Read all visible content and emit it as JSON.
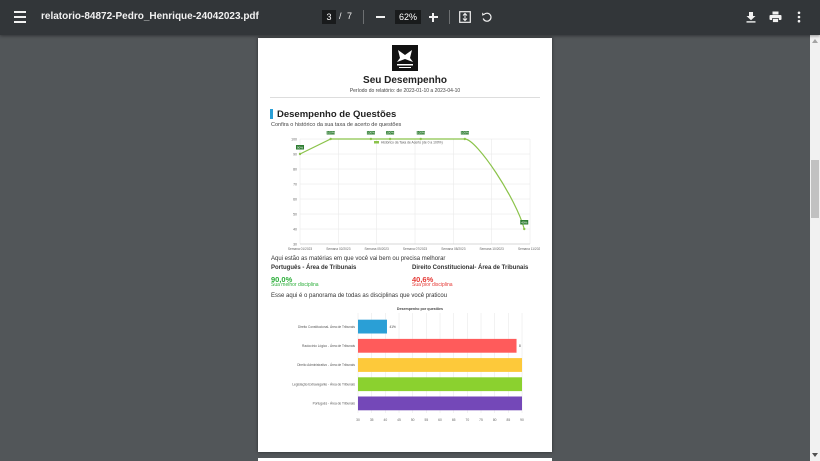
{
  "toolbar": {
    "filename": "relatorio-84872-Pedro_Henrique-24042023.pdf",
    "current_page": "3",
    "page_separator": "/",
    "total_pages": "7",
    "zoom": "62%"
  },
  "report": {
    "title": "Seu Desempenho",
    "period": "Período do relatório: de 2023-01-10 a 2023-04-10",
    "section_title": "Desempenho de Questões",
    "section_subtitle": "Confira o histórico da sua taxa de acerto de questões",
    "subjects_intro": "Aqui estão as matérias em que você vai bem ou precisa melhorar",
    "best_subject": "Português - Área de Tribunais",
    "best_pct": "90,0%",
    "best_hint": "Sua melhor disciplina",
    "worst_subject": "Direito Constitucional- Área de Tribunais",
    "worst_pct": "40,6%",
    "worst_hint": "Sua pior disciplina",
    "panorama_intro": "Esse aqui é o panorama de todas as disciplinas que você praticou"
  },
  "chart_data": [
    {
      "type": "line",
      "title": "",
      "legend": "Histórico da Taxa de Acerto (de 0 a 100%)",
      "legend_position": "top-center",
      "categories": [
        "Semana 01/2023",
        "Semana 02/2023",
        "Semana 05/2023",
        "Semana 07/2023",
        "Semana 08/2023",
        "Semana 10/2023",
        "Semana 11/2023"
      ],
      "x": [
        0,
        1,
        2,
        3,
        4,
        5,
        6
      ],
      "points_x": [
        0,
        0.8,
        1.85,
        2.35,
        3.15,
        4.3,
        5.85
      ],
      "values": [
        90,
        100,
        100,
        100,
        100,
        100,
        40
      ],
      "point_labels": [
        "90%",
        "100%",
        "100%",
        "100%",
        "100%",
        "100%",
        "40%"
      ],
      "ylim": [
        30,
        100
      ],
      "yticks": [
        30,
        40,
        50,
        60,
        70,
        80,
        90,
        100
      ],
      "color": "#8bc34a",
      "grid": true
    },
    {
      "type": "bar",
      "orientation": "horizontal",
      "title": "Desempenho por questões",
      "categories": [
        "Direito Constitucional- Área de Tribunais",
        "Raciocínio Lógico - Área de Tribunais",
        "Direito Administrativo - Área de Tribunais",
        "Legislação Extravagante - Área de Tribunais",
        "Português - Área de Tribunais"
      ],
      "values": [
        40.6,
        88,
        90,
        90,
        90
      ],
      "value_labels": [
        "41%",
        "8",
        "",
        "",
        ""
      ],
      "colors": [
        "#2a9fd6",
        "#ff5b5b",
        "#fdc93a",
        "#8bd12f",
        "#7448b8"
      ],
      "xlim": [
        30,
        90
      ],
      "xticks": [
        30,
        35,
        40,
        45,
        50,
        55,
        60,
        65,
        70,
        75,
        80,
        85,
        90
      ],
      "grid": true
    }
  ]
}
